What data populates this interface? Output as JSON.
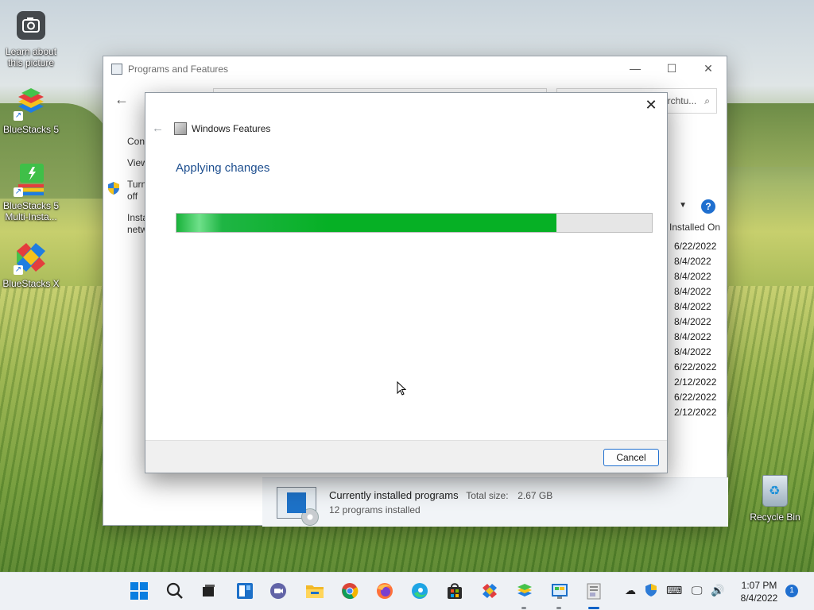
{
  "desktop": {
    "icons": [
      {
        "label": "Learn about this picture"
      },
      {
        "label": "BlueStacks 5"
      },
      {
        "label": "BlueStacks 5 Multi-Insta..."
      },
      {
        "label": "BlueStacks X"
      }
    ],
    "recycle_bin": "Recycle Bin"
  },
  "programs_window": {
    "title": "Programs and Features",
    "search_placeholder": "Searchtu...",
    "sidebar": [
      "Cont",
      "View",
      "Turn\noff",
      "Insta\nnetw"
    ],
    "column_header": "Installed On",
    "installed_dates": [
      "6/22/2022",
      "8/4/2022",
      "8/4/2022",
      "8/4/2022",
      "8/4/2022",
      "8/4/2022",
      "8/4/2022",
      "8/4/2022",
      "6/22/2022",
      "2/12/2022",
      "6/22/2022",
      "2/12/2022"
    ],
    "status": {
      "title": "Currently installed programs",
      "size_label": "Total size:",
      "size_value": "2.67 GB",
      "count": "12 programs installed"
    }
  },
  "features_dialog": {
    "title": "Windows Features",
    "heading": "Applying changes",
    "progress": 0.8,
    "cancel_label": "Cancel"
  },
  "taskbar": {
    "time": "1:07 PM",
    "date": "8/4/2022",
    "notification_count": "1"
  },
  "colors": {
    "progress_green": "#06b025",
    "accent_blue": "#1f6fcf",
    "heading_blue": "#1e4f8f"
  }
}
